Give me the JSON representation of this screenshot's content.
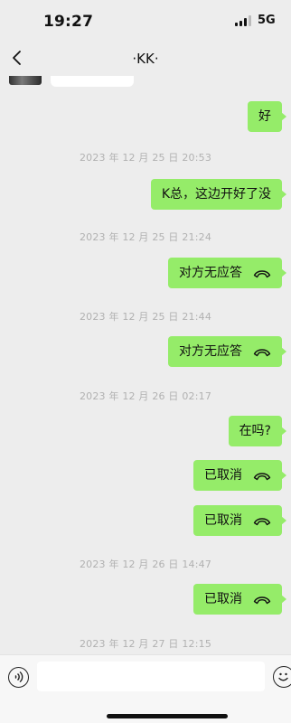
{
  "status_bar": {
    "time": "19:27",
    "network": "5G"
  },
  "nav": {
    "title": "·KK·"
  },
  "messages": [
    {
      "kind": "text",
      "text": "好"
    },
    {
      "kind": "timestamp",
      "text": "2023 年 12 月 25 日 20:53"
    },
    {
      "kind": "text",
      "text": "K总，这边开好了没"
    },
    {
      "kind": "timestamp",
      "text": "2023 年 12 月 25 日 21:24"
    },
    {
      "kind": "call",
      "text": "对方无应答",
      "icon": "phone-hangup-icon"
    },
    {
      "kind": "timestamp",
      "text": "2023 年 12 月 25 日 21:44"
    },
    {
      "kind": "call",
      "text": "对方无应答",
      "icon": "phone-hangup-icon"
    },
    {
      "kind": "timestamp",
      "text": "2023 年 12 月 26 日 02:17"
    },
    {
      "kind": "text",
      "text": "在吗?"
    },
    {
      "kind": "call",
      "text": "已取消",
      "icon": "phone-hangup-icon"
    },
    {
      "kind": "call",
      "text": "已取消",
      "icon": "phone-hangup-icon"
    },
    {
      "kind": "timestamp",
      "text": "2023 年 12 月 26 日 14:47"
    },
    {
      "kind": "call",
      "text": "已取消",
      "icon": "phone-hangup-icon"
    },
    {
      "kind": "timestamp",
      "text": "2023 年 12 月 27 日 12:15"
    }
  ],
  "input": {
    "value": "",
    "placeholder": ""
  },
  "colors": {
    "background": "#ededed",
    "bubble_outgoing": "#95ec69",
    "timestamp_text": "#b1b1b1"
  }
}
